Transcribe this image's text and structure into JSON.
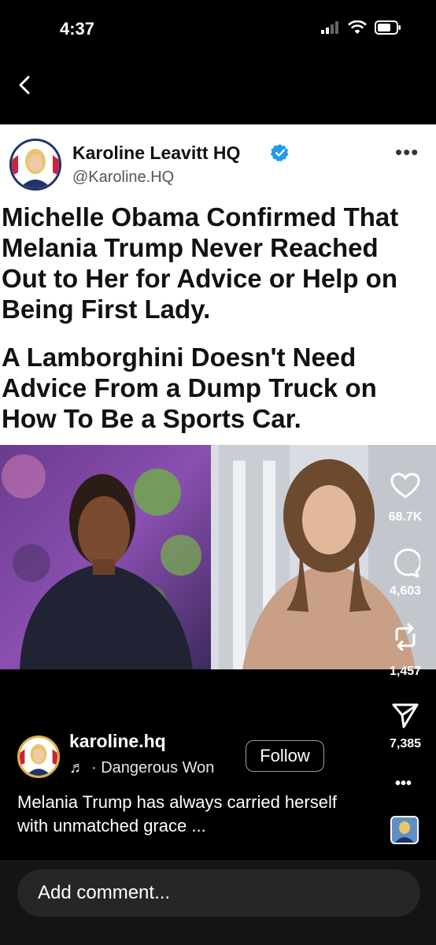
{
  "status_bar": {
    "time": "4:37"
  },
  "tweet": {
    "name": "Karoline Leavitt HQ",
    "handle": "@Karoline.HQ",
    "headline": "Michelle Obama Confirmed That Melania Trump Never Reached Out to Her for Advice or Help on Being First Lady.",
    "subhead": "A Lamborghini Doesn't Need Advice From a Dump Truck on How To Be a Sports Car."
  },
  "actions": {
    "likes": "68.7K",
    "comments": "4,603",
    "reposts": "1,457",
    "shares": "7,385"
  },
  "post": {
    "username": "karoline.hq",
    "music": "· Dangerous Won",
    "follow_label": "Follow",
    "caption": "Melania Trump has always carried herself with unmatched grace ..."
  },
  "comment": {
    "placeholder": "Add comment..."
  },
  "colors": {
    "verified": "#1d9bf0",
    "background": "#000000",
    "card": "#ffffff"
  }
}
